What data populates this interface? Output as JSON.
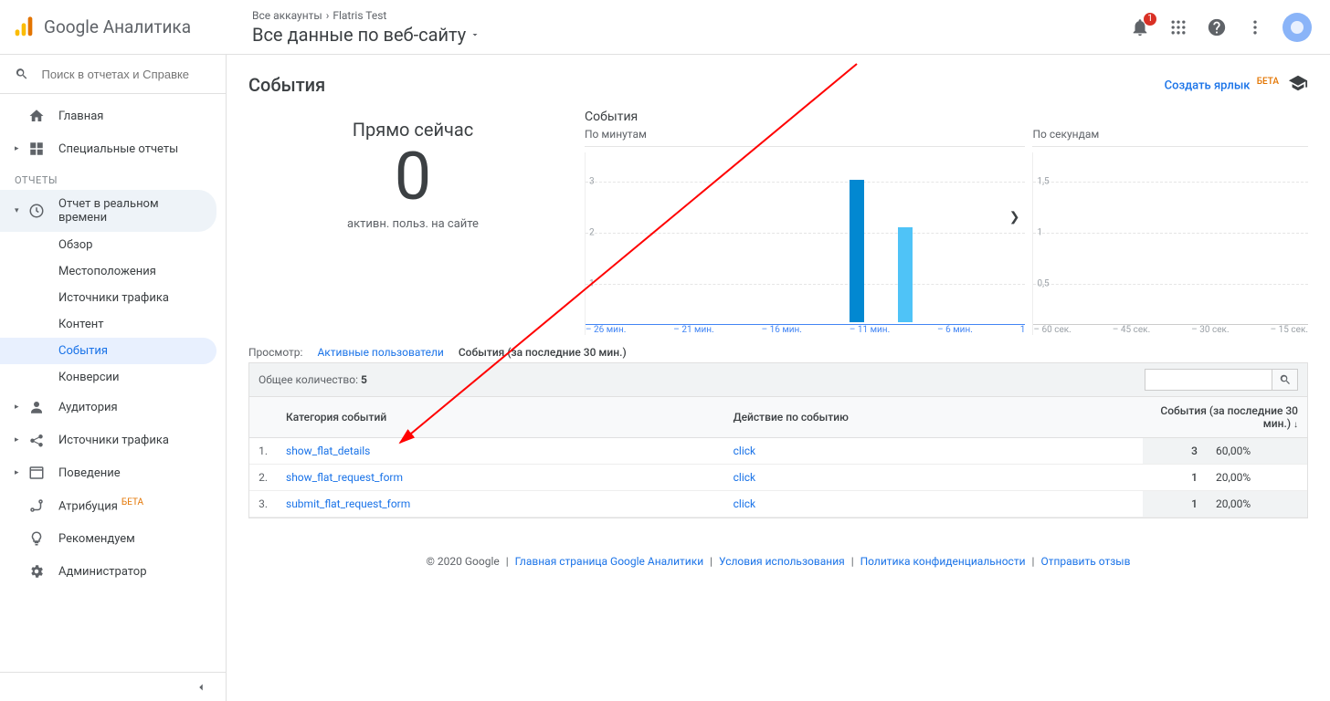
{
  "header": {
    "product": "Google Аналитика",
    "crumb_all": "Все аккаунты",
    "crumb_account": "Flatris Test",
    "view_name": "Все данные по веб-сайту",
    "notif_count": "1",
    "search_placeholder": "Поиск в отчетах и Справке"
  },
  "sidebar": {
    "home": "Главная",
    "custom": "Специальные отчеты",
    "reports_section": "ОТЧЕТЫ",
    "realtime": "Отчет в реальном времени",
    "realtime_items": [
      "Обзор",
      "Местоположения",
      "Источники трафика",
      "Контент",
      "События",
      "Конверсии"
    ],
    "audience": "Аудитория",
    "acquisition": "Источники трафика",
    "behavior": "Поведение",
    "attribution": "Атрибуция",
    "attribution_beta": "БЕТА",
    "recommend": "Рекомендуем",
    "admin": "Администратор"
  },
  "page": {
    "title": "События",
    "shortcut": "Создать ярлык",
    "shortcut_beta": "БЕТА",
    "now_label": "Прямо сейчас",
    "now_count": "0",
    "now_sub": "активн. польз. на сайте",
    "tabs_label": "Просмотр:",
    "tab_active_users": "Активные пользователи",
    "tab_events": "События (за последние 30 мин.)"
  },
  "chart_data": [
    {
      "type": "bar",
      "title": "События",
      "subtitle": "По минутам",
      "x_ticks": [
        "– 26 мин.",
        "– 21 мин.",
        "– 16 мин.",
        "– 11 мин.",
        "– 6 мин.",
        "1"
      ],
      "y_ticks": [
        "1",
        "2",
        "3"
      ],
      "ylim": [
        0,
        3.5
      ],
      "series": [
        {
          "position_min": 11,
          "value": 3,
          "active": true
        },
        {
          "position_min": 8,
          "value": 2,
          "active": false
        }
      ]
    },
    {
      "type": "bar",
      "title": "",
      "subtitle": "По секундам",
      "x_ticks": [
        "– 60 сек.",
        "– 45 сек.",
        "– 30 сек.",
        "– 15 сек."
      ],
      "y_ticks": [
        "0,5",
        "1",
        "1,5"
      ],
      "ylim": [
        0,
        1.8
      ],
      "series": []
    }
  ],
  "table": {
    "total_label": "Общее количество:",
    "total_value": "5",
    "col_category": "Категория событий",
    "col_action": "Действие по событию",
    "col_events": "События (за последние 30 мин.)",
    "rows": [
      {
        "idx": "1.",
        "category": "show_flat_details",
        "action": "click",
        "count": "3",
        "pct": "60,00%"
      },
      {
        "idx": "2.",
        "category": "show_flat_request_form",
        "action": "click",
        "count": "1",
        "pct": "20,00%"
      },
      {
        "idx": "3.",
        "category": "submit_flat_request_form",
        "action": "click",
        "count": "1",
        "pct": "20,00%"
      }
    ]
  },
  "footer": {
    "copyright": "© 2020 Google",
    "link_home": "Главная страница Google Аналитики",
    "link_terms": "Условия использования",
    "link_privacy": "Политика конфиденциальности",
    "link_feedback": "Отправить отзыв"
  }
}
